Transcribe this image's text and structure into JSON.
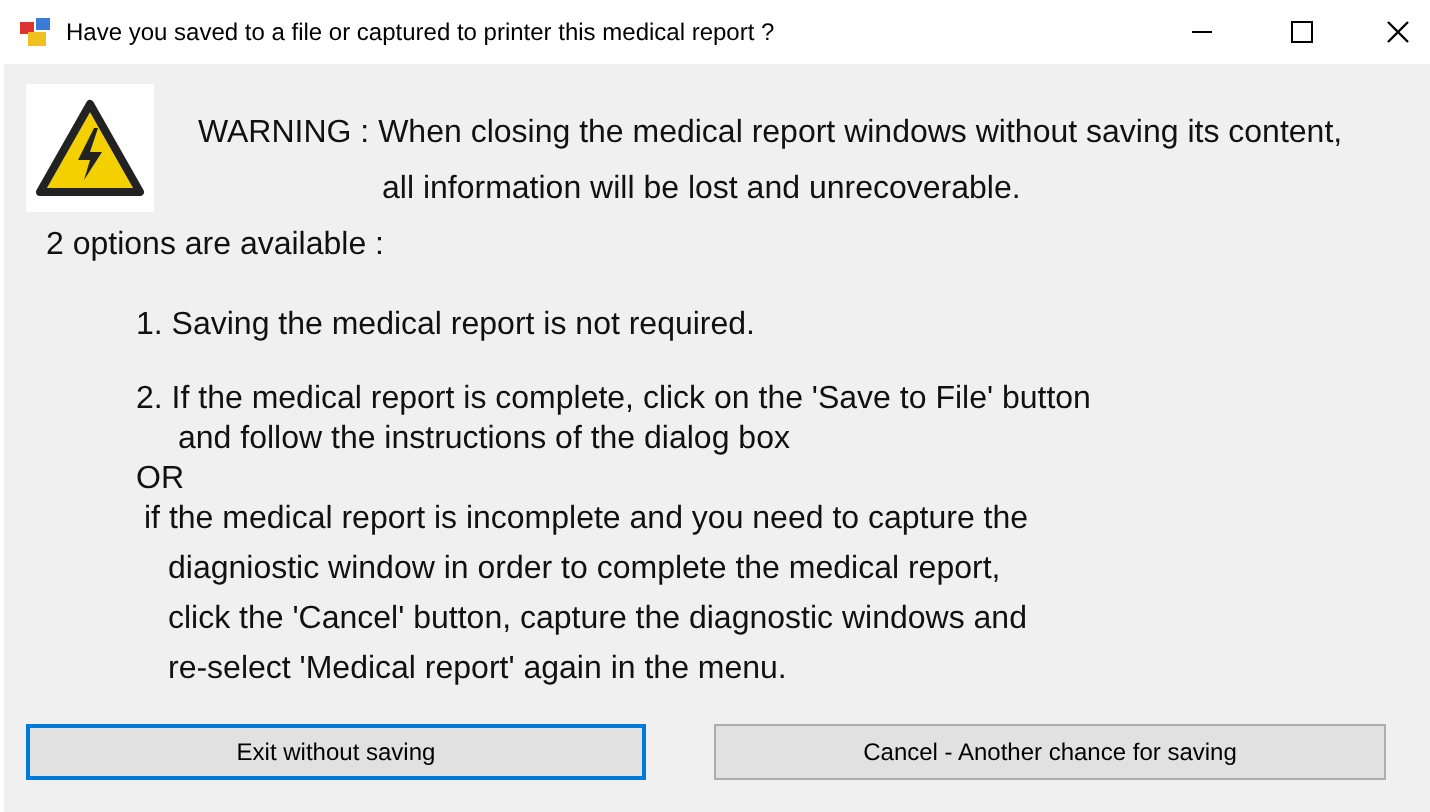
{
  "window": {
    "title": "Have you saved to a file or captured to printer this medical report ?"
  },
  "warning": {
    "lines": [
      "WARNING : When closing the medical report windows without saving its content,",
      "all information will be lost and unrecoverable."
    ]
  },
  "options_heading": "2 options are available :",
  "lines": [
    {
      "kind": "item",
      "text": "1. Saving the medical report is not required."
    },
    {
      "kind": "item",
      "text": "2. If the medical report is complete, click on the 'Save to File' button"
    },
    {
      "kind": "continuation",
      "text": "and follow the instructions of the dialog box"
    },
    {
      "kind": "separator",
      "text": "OR"
    },
    {
      "kind": "note",
      "text": "if the medical report is incomplete and  you need to capture the"
    },
    {
      "kind": "note2",
      "text": "diagniostic window in order to complete the medical report,"
    },
    {
      "kind": "note2",
      "text": "click the 'Cancel' button, capture the diagnostic windows and"
    },
    {
      "kind": "note2",
      "text": "re-select 'Medical report' again in the menu."
    }
  ],
  "buttons": [
    {
      "label": "Exit without saving",
      "selected": true
    },
    {
      "label": "Cancel - Another chance for saving",
      "selected": false
    }
  ]
}
